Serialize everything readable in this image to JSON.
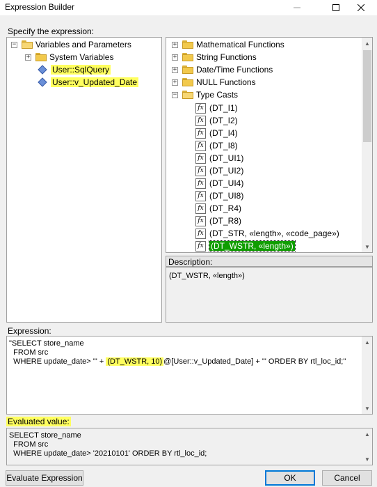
{
  "window": {
    "title": "Expression Builder"
  },
  "labels": {
    "specify": "Specify the expression:",
    "description": "Description:",
    "expression": "Expression:",
    "evaluated": "Evaluated value:"
  },
  "left_tree": {
    "root": "Variables and Parameters",
    "items": [
      {
        "label": "System Variables"
      },
      {
        "label": "User::SqlQuery"
      },
      {
        "label": "User::v_Updated_Date"
      }
    ]
  },
  "right_tree": {
    "folders": [
      "Mathematical Functions",
      "String Functions",
      "Date/Time Functions",
      "NULL Functions",
      "Type Casts"
    ],
    "casts": [
      "(DT_I1)",
      "(DT_I2)",
      "(DT_I4)",
      "(DT_I8)",
      "(DT_UI1)",
      "(DT_UI2)",
      "(DT_UI4)",
      "(DT_UI8)",
      "(DT_R4)",
      "(DT_R8)",
      "(DT_STR, «length», «code_page»)",
      "(DT_WSTR, «length»)"
    ]
  },
  "description_text": "(DT_WSTR, «length»)",
  "expression": {
    "line1": "\"SELECT store_name",
    "line2": "  FROM src",
    "line3_a": "  WHERE update_date> '\" + ",
    "line3_hl": "(DT_WSTR, 10)",
    "line3_b": "@[User::v_Updated_Date] + \"' ORDER BY rtl_loc_id;\""
  },
  "evaluated": {
    "line1": "SELECT store_name",
    "line2": "  FROM src",
    "line3": "  WHERE update_date> '20210101' ORDER BY rtl_loc_id;"
  },
  "buttons": {
    "evaluate": "Evaluate Expression",
    "ok": "OK",
    "cancel": "Cancel"
  },
  "colors": {
    "highlight": "#ffff5e",
    "selected": "#0f9d00",
    "accent": "#0078d7"
  }
}
